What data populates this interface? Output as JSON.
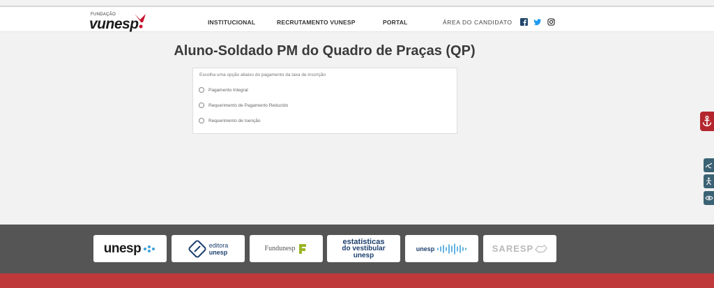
{
  "header": {
    "logo_small": "FUNDAÇÃO",
    "logo_main": "vunesp",
    "nav": {
      "institucional": "INSTITUCIONAL",
      "recrutamento": "RECRUTAMENTO VUNESP",
      "portal": "PORTAL",
      "area": "ÁREA DO CANDIDATO"
    },
    "social_icons": [
      "facebook-icon",
      "twitter-icon",
      "instagram-icon"
    ]
  },
  "main": {
    "title": "Aluno-Soldado PM do Quadro de Praças (QP)",
    "prompt": "Escolha uma opção abaixo do pagamento da taxa de inscrição",
    "options": [
      "Pagamento Integral",
      "Requerimento de Pagamento Reduzido",
      "Requerimento de Isenção"
    ]
  },
  "footer": {
    "partners": {
      "unesp": "unesp",
      "editora_1": "editora",
      "editora_2": "unesp",
      "fundunesp": "Fundunesp",
      "est_1": "estatísticas",
      "est_2": "do vestibular",
      "est_3": "unesp",
      "radio": "unesp",
      "saresp": "SARESP"
    }
  },
  "colors": {
    "brand_red": "#c0393a",
    "footer_gray": "#555555",
    "accessibility_blue": "#3b6274",
    "unesp_navy": "#1c3f6e"
  }
}
